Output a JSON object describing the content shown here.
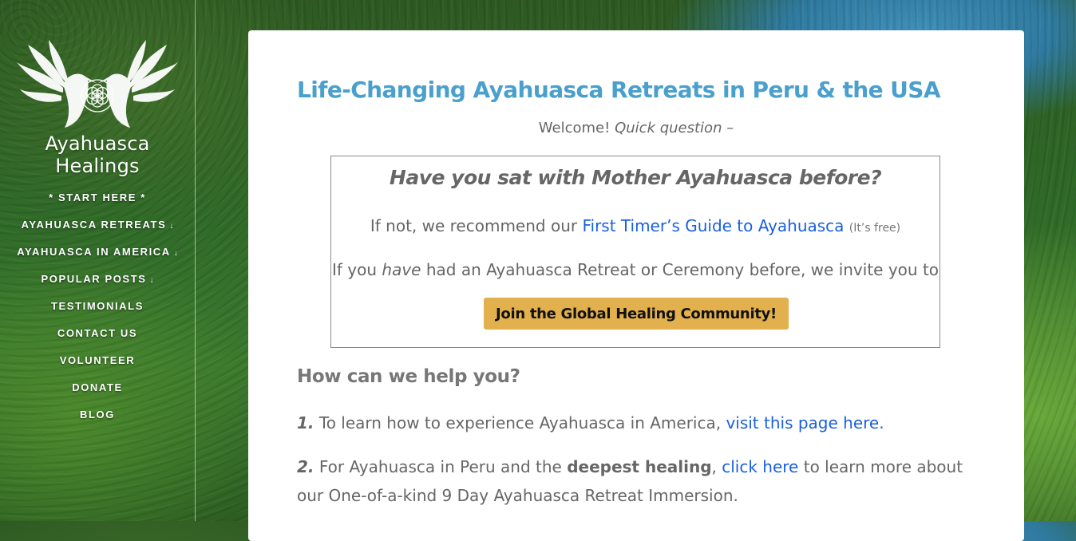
{
  "sidebar": {
    "logo_text": "Ayahuasca Healings",
    "nav": [
      {
        "label": "* START HERE *",
        "has_dropdown": false
      },
      {
        "label": "AYAHUASCA RETREATS",
        "has_dropdown": true
      },
      {
        "label": "AYAHUASCA IN AMERICA",
        "has_dropdown": true
      },
      {
        "label": "POPULAR POSTS",
        "has_dropdown": true
      },
      {
        "label": "TESTIMONIALS",
        "has_dropdown": false
      },
      {
        "label": "CONTACT US",
        "has_dropdown": false
      },
      {
        "label": "VOLUNTEER",
        "has_dropdown": false
      },
      {
        "label": "DONATE",
        "has_dropdown": false
      },
      {
        "label": "BLOG",
        "has_dropdown": false
      }
    ],
    "dropdown_icon": "double-chevron-down-icon"
  },
  "main": {
    "title": "Life-Changing Ayahuasca Retreats in Peru & the USA",
    "welcome": "Welcome!",
    "welcome_italic": "Quick question –",
    "box": {
      "question": "Have you sat with Mother Ayahuasca before?",
      "line1_prefix": "If not, we recommend our",
      "line1_link": "First Timer’s Guide to Ayahuasca",
      "line1_note": "(It’s free)",
      "line2_prefix": "If you",
      "line2_italic": "have",
      "line2_suffix": "had an Ayahuasca Retreat or Ceremony before, we invite you to",
      "button": "Join the Global Healing Community!"
    },
    "help_heading": "How can we help you?",
    "item1": {
      "number": "1.",
      "text": "To learn how to experience Ayahuasca in America,",
      "link": "visit this page here."
    },
    "item2": {
      "number": "2.",
      "text_a": "For Ayahuasca in Peru and the",
      "bold": "deepest healing",
      "comma": ",",
      "link": "click here",
      "text_b": "to learn more about our One-of-a-kind 9 Day Ayahuasca Retreat Immersion."
    }
  },
  "colors": {
    "title": "#4aa0cc",
    "link": "#1a5fe0",
    "button": "#e2b04d",
    "body_text": "#666666"
  }
}
